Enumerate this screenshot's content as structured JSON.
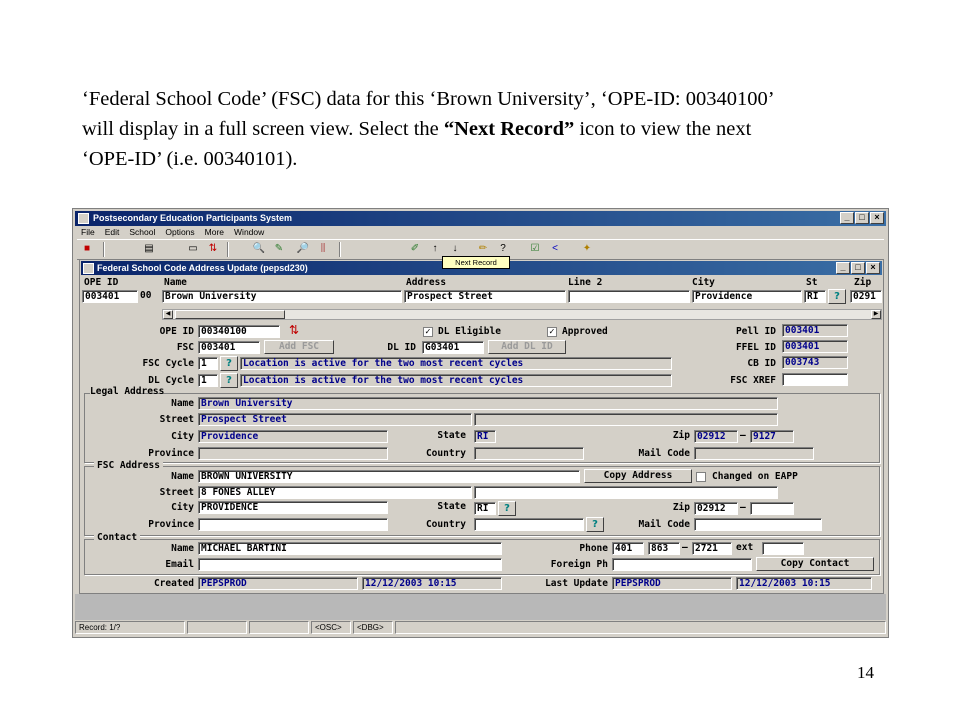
{
  "caption": {
    "l1a": "‘Federal School Code’ (FSC) data for this ‘Brown University’, ‘OPE-ID: 00340100’",
    "l2a": "will display in a full screen view.  Select the ",
    "l2b": "“Next Record”",
    "l2c": " icon to view the next",
    "l3a": "‘OPE-ID’ (i.e. 00340101)."
  },
  "slide_number": "14",
  "window": {
    "title": "Postsecondary Education Participants System",
    "menu": [
      "File",
      "Edit",
      "School",
      "Options",
      "More",
      "Window"
    ],
    "tooltip": "Next Record"
  },
  "form": {
    "title": "Federal School Code Address Update (pepsd230)",
    "grid": {
      "headers": {
        "ope": "OPE ID",
        "name": "Name",
        "address": "Address",
        "line2": "Line 2",
        "city": "City",
        "st": "St",
        "zip": "Zip"
      },
      "row": {
        "ope": "003401",
        "ope_suffix": "00",
        "name": "Brown University",
        "address": "Prospect Street",
        "line2": "",
        "city": "Providence",
        "st": "RI",
        "zip": "0291"
      }
    },
    "ope_id": {
      "label": "OPE ID",
      "value": "00340100"
    },
    "fsc": {
      "label": "FSC",
      "value": "003401",
      "add_label": "Add FSC"
    },
    "dl_id": {
      "label": "DL ID",
      "value": "G03401",
      "add_label": "Add DL ID"
    },
    "dl_eligible": {
      "label": "DL Eligible",
      "checked": true
    },
    "approved": {
      "label": "Approved",
      "checked": true
    },
    "fsc_cycle": {
      "label": "FSC Cycle",
      "value": "1",
      "desc": "Location is active for the two most recent cycles"
    },
    "dl_cycle": {
      "label": "DL Cycle",
      "value": "1",
      "desc": "Location is active for the two most recent cycles"
    },
    "pell_id": {
      "label": "Pell ID",
      "value": "003401"
    },
    "ffel_id": {
      "label": "FFEL ID",
      "value": "003401"
    },
    "cb_id": {
      "label": "CB ID",
      "value": "003743"
    },
    "fsc_xref": {
      "label": "FSC XREF",
      "value": ""
    },
    "legal": {
      "group_label": "Legal Address",
      "name_label": "Name",
      "name": "Brown University",
      "street_label": "Street",
      "street": "Prospect Street",
      "street2": "",
      "city_label": "City",
      "city": "Providence",
      "state_label": "State",
      "state": "RI",
      "zip_label": "Zip",
      "zip": "02912",
      "zip4": "9127",
      "province_label": "Province",
      "province": "",
      "country_label": "Country",
      "country": "",
      "mail_label": "Mail Code",
      "mail": ""
    },
    "fsc_address": {
      "group_label": "FSC Address",
      "name_label": "Name",
      "name": "BROWN UNIVERSITY",
      "copy_label": "Copy Address",
      "changed_label": "Changed on EAPP",
      "street_label": "Street",
      "street": "8 FONES ALLEY",
      "street2": "",
      "city_label": "City",
      "city": "PROVIDENCE",
      "state_label": "State",
      "state": "RI",
      "zip_label": "Zip",
      "zip": "02912",
      "zip4": "",
      "province_label": "Province",
      "province": "",
      "country_label": "Country",
      "country": "",
      "mail_label": "Mail Code",
      "mail": ""
    },
    "contact": {
      "group_label": "Contact",
      "name_label": "Name",
      "name": "MICHAEL BARTINI",
      "phone_label": "Phone",
      "phone_area": "401",
      "phone_pre": "863",
      "phone_num": "2721",
      "ext_label": "ext",
      "ext": "",
      "email_label": "Email",
      "email": "",
      "foreign_label": "Foreign Ph",
      "foreign": "",
      "copy_label": "Copy Contact"
    },
    "created": {
      "label": "Created",
      "by": "PEPSPROD",
      "date": "12/12/2003 10:15"
    },
    "last_update": {
      "label": "Last Update",
      "by": "PEPSPROD",
      "date": "12/12/2003 10:15"
    }
  },
  "status_bar": {
    "record": "Record: 1/?",
    "osc": "<OSC>",
    "dbg": "<DBG>"
  }
}
